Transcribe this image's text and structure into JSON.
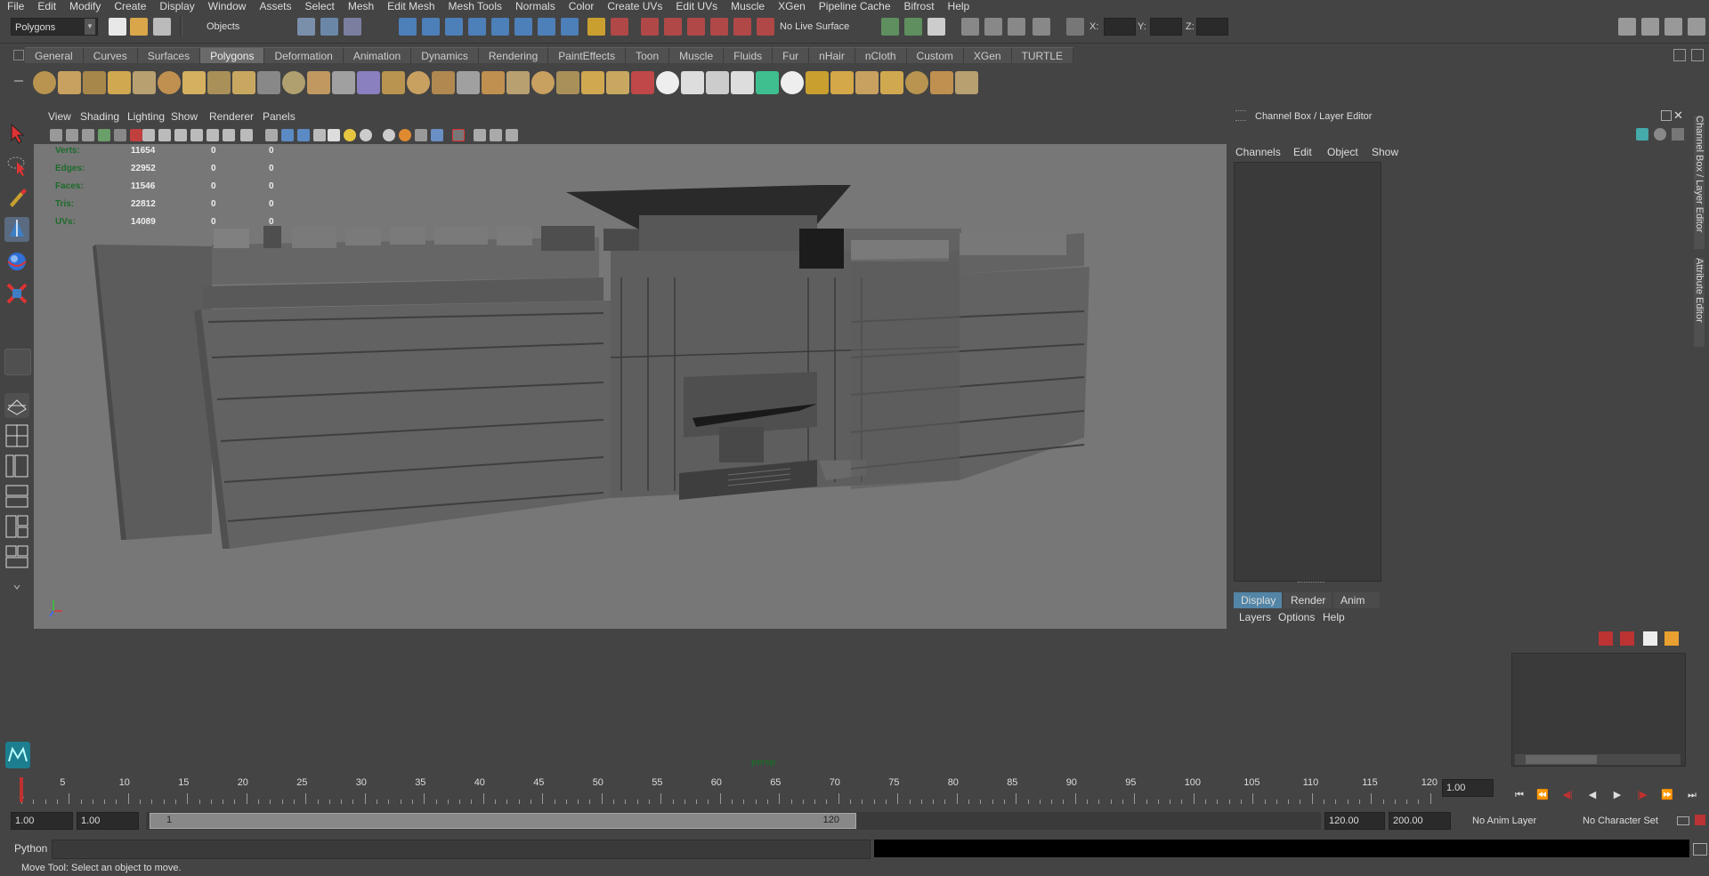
{
  "menubar": [
    "File",
    "Edit",
    "Modify",
    "Create",
    "Display",
    "Window",
    "Assets",
    "Select",
    "Mesh",
    "Edit Mesh",
    "Mesh Tools",
    "Normals",
    "Color",
    "Create UVs",
    "Edit UVs",
    "Muscle",
    "XGen",
    "Pipeline Cache",
    "Bifrost",
    "Help"
  ],
  "statusline": {
    "menuset": "Polygons",
    "selection_mode": "Objects",
    "live_surface": "No Live Surface",
    "x_label": "X:",
    "y_label": "Y:",
    "z_label": "Z:"
  },
  "shelf": {
    "tabs": [
      "General",
      "Curves",
      "Surfaces",
      "Polygons",
      "Deformation",
      "Animation",
      "Dynamics",
      "Rendering",
      "PaintEffects",
      "Toon",
      "Muscle",
      "Fluids",
      "Fur",
      "nHair",
      "nCloth",
      "Custom",
      "XGen",
      "TURTLE"
    ],
    "active_tab": "Polygons",
    "icons": [
      "poly-sphere-icon",
      "poly-cube-icon",
      "poly-cylinder-icon",
      "poly-cone-icon",
      "poly-plane-icon",
      "poly-torus-icon",
      "poly-prism-icon",
      "poly-pipe-icon",
      "poly-helix-icon",
      "soccer-ball-icon",
      "combine-icon",
      "separate-icon",
      "extract-icon",
      "smooth-icon",
      "boolean-icon",
      "mirror-icon",
      "append-icon",
      "bridge-icon",
      "fill-hole-icon",
      "extrude-icon",
      "bevel-icon",
      "merge-icon",
      "wedge-icon",
      "poke-icon",
      "crease-icon",
      "uv-editor-icon",
      "planar-map-icon",
      "cylindrical-map-icon",
      "spherical-map-icon",
      "auto-map-icon",
      "checker-icon",
      "checker-map-icon",
      "unfold-icon",
      "layout-icon",
      "transfer-icon",
      "sew-icon",
      "cut-icon",
      "normal-icon"
    ]
  },
  "viewport": {
    "menus": [
      "View",
      "Shading",
      "Lighting",
      "Show",
      "Renderer",
      "Panels"
    ],
    "camera_label": "persp",
    "hud": [
      {
        "label": "Verts:",
        "v1": "11654",
        "v2": "0",
        "v3": "0"
      },
      {
        "label": "Edges:",
        "v1": "22952",
        "v2": "0",
        "v3": "0"
      },
      {
        "label": "Faces:",
        "v1": "11546",
        "v2": "0",
        "v3": "0"
      },
      {
        "label": "Tris:",
        "v1": "22812",
        "v2": "0",
        "v3": "0"
      },
      {
        "label": "UVs:",
        "v1": "14089",
        "v2": "0",
        "v3": "0"
      }
    ]
  },
  "right_panel": {
    "title": "Channel Box / Layer Editor",
    "channel_menus": [
      "Channels",
      "Edit",
      "Object",
      "Show"
    ],
    "layer_tabs": [
      "Display",
      "Render",
      "Anim"
    ],
    "active_layer_tab": "Display",
    "layer_menus": [
      "Layers",
      "Options",
      "Help"
    ],
    "side_tab_1": "Channel Box / Layer Editor",
    "side_tab_2": "Attribute Editor"
  },
  "timeline": {
    "ticks": [
      "5",
      "10",
      "15",
      "20",
      "25",
      "30",
      "35",
      "40",
      "45",
      "50",
      "55",
      "60",
      "65",
      "70",
      "75",
      "80",
      "85",
      "90",
      "95",
      "100",
      "105",
      "110",
      "115",
      "120"
    ],
    "current_frame_label": "1",
    "current_time": "1.00"
  },
  "range": {
    "start": "1.00",
    "anim_start": "1.00",
    "range_start_inner": "1",
    "range_end_inner": "120",
    "range_end": "120.00",
    "anim_end": "200.00",
    "anim_layer": "No Anim Layer",
    "character_set": "No Character Set"
  },
  "command_line": {
    "language": "Python"
  },
  "help_line": "Move Tool: Select an object to move.",
  "colors": {
    "accent": "#5285a6",
    "hud_green": "#1d6b2a",
    "viewport_bg": "#777777",
    "key_red": "#c03030"
  }
}
